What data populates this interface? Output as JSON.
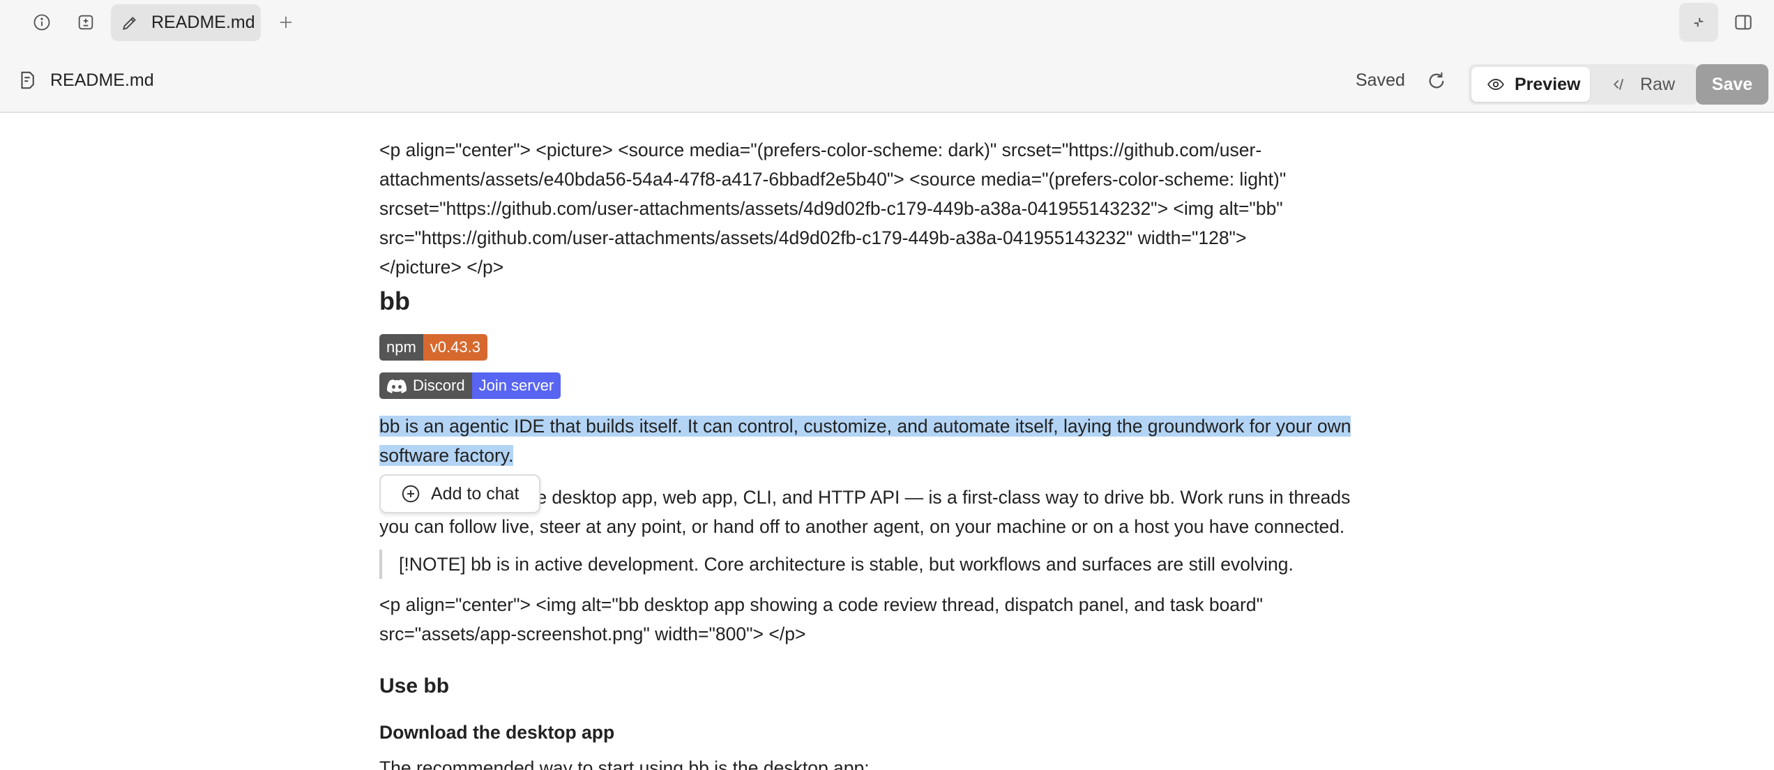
{
  "tabbar": {
    "active_tab": "README.md"
  },
  "file_header": {
    "filename": "README.md",
    "status": "Saved",
    "preview_label": "Preview",
    "raw_label": "Raw",
    "save_label": "Save"
  },
  "doc": {
    "p1": "<p align=\"center\"> <picture> <source media=\"(prefers-color-scheme: dark)\" srcset=\"https://github.com/user-\nattachments/assets/e40bda56-54a4-47f8-a417-6bbadf2e5b40\"> <source media=\"(prefers-color-scheme: light)\"\nsrcset=\"https://github.com/user-attachments/assets/4d9d02fb-c179-449b-a38a-041955143232\"> <img alt=\"bb\"\nsrc=\"https://github.com/user-attachments/assets/4d9d02fb-c179-449b-a38a-041955143232\" width=\"128\">\n</picture> </p>",
    "title": "bb",
    "badge_npm_left": "npm",
    "badge_npm_right": "v0.43.3",
    "badge_discord_left": "Discord",
    "badge_discord_right": "Join server",
    "p2_line1": "bb is an agentic IDE that builds itself. It can control, customize, and automate itself, laying the groundwork for your own",
    "p2_line2": "software factory.",
    "p3": "Every surface — the desktop app, web app, CLI, and HTTP API — is a first-class way to drive bb. Work runs in threads\nyou can follow live, steer at any point, or hand off to another agent, on your machine or on a host you have connected.",
    "note": "[!NOTE] bb is in active development. Core architecture is stable, but workflows and surfaces are still evolving.",
    "p4": "<p align=\"center\"> <img alt=\"bb desktop app showing a code review thread, dispatch panel, and task board\"\nsrc=\"assets/app-screenshot.png\" width=\"800\"> </p>",
    "h2": "Use bb",
    "h3": "Download the desktop app",
    "p5": "The recommended way to start using bb is the desktop app:"
  },
  "popup": {
    "add_to_chat": "Add to chat"
  },
  "colors": {
    "selection": "#b3d4f5",
    "discord": "#5865f2",
    "npm_version": "#d7692f",
    "save_disabled": "#9e9e9e"
  }
}
